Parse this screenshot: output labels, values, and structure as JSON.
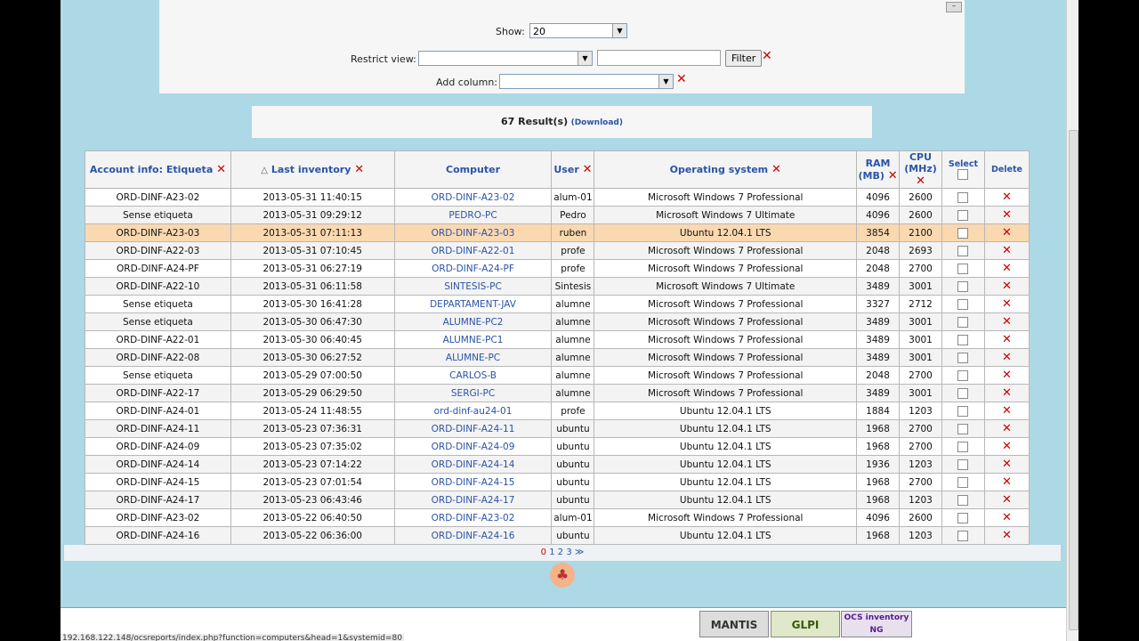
{
  "filter": {
    "show_label": "Show:",
    "show_value": "20",
    "restrict_label": "Restrict view:",
    "restrict_value": "",
    "restrict_text": "",
    "filter_button": "Filter",
    "add_column_label": "Add column:",
    "add_column_value": ""
  },
  "results": {
    "count_text": "67 Result(s)",
    "download_text": "(Download)"
  },
  "table": {
    "headers": {
      "account": "Account info: Etiqueta",
      "last_inventory": "Last inventory",
      "computer": "Computer",
      "user": "User",
      "os": "Operating system",
      "ram": "RAM (MB)",
      "cpu": "CPU (MHz)",
      "select": "Select",
      "delete": "Delete"
    },
    "rows": [
      [
        "ORD-DINF-A23-02",
        "2013-05-31 11:40:15",
        "ORD-DINF-A23-02",
        "alum-01",
        "Microsoft Windows 7 Professional",
        "4096",
        "2600"
      ],
      [
        "Sense etiqueta",
        "2013-05-31 09:29:12",
        "PEDRO-PC",
        "Pedro",
        "Microsoft Windows 7 Ultimate",
        "4096",
        "2600"
      ],
      [
        "ORD-DINF-A23-03",
        "2013-05-31 07:11:13",
        "ORD-DINF-A23-03",
        "ruben",
        "Ubuntu 12.04.1 LTS",
        "3854",
        "2100"
      ],
      [
        "ORD-DINF-A22-03",
        "2013-05-31 07:10:45",
        "ORD-DINF-A22-01",
        "profe",
        "Microsoft Windows 7 Professional",
        "2048",
        "2693"
      ],
      [
        "ORD-DINF-A24-PF",
        "2013-05-31 06:27:19",
        "ORD-DINF-A24-PF",
        "profe",
        "Microsoft Windows 7 Professional",
        "2048",
        "2700"
      ],
      [
        "ORD-DINF-A22-10",
        "2013-05-31 06:11:58",
        "SINTESIS-PC",
        "Sintesis",
        "Microsoft Windows 7 Ultimate",
        "3489",
        "3001"
      ],
      [
        "Sense etiqueta",
        "2013-05-30 16:41:28",
        "DEPARTAMENT-JAV",
        "alumne",
        "Microsoft Windows 7 Professional",
        "3327",
        "2712"
      ],
      [
        "Sense etiqueta",
        "2013-05-30 06:47:30",
        "ALUMNE-PC2",
        "alumne",
        "Microsoft Windows 7 Professional",
        "3489",
        "3001"
      ],
      [
        "ORD-DINF-A22-01",
        "2013-05-30 06:40:45",
        "ALUMNE-PC1",
        "alumne",
        "Microsoft Windows 7 Professional",
        "3489",
        "3001"
      ],
      [
        "ORD-DINF-A22-08",
        "2013-05-30 06:27:52",
        "ALUMNE-PC",
        "alumne",
        "Microsoft Windows 7 Professional",
        "3489",
        "3001"
      ],
      [
        "Sense etiqueta",
        "2013-05-29 07:00:50",
        "CARLOS-B",
        "alumne",
        "Microsoft Windows 7 Professional",
        "2048",
        "2700"
      ],
      [
        "ORD-DINF-A22-17",
        "2013-05-29 06:29:50",
        "SERGI-PC",
        "alumne",
        "Microsoft Windows 7 Professional",
        "3489",
        "3001"
      ],
      [
        "ORD-DINF-A24-01",
        "2013-05-24 11:48:55",
        "ord-dinf-au24-01",
        "profe",
        "Ubuntu 12.04.1 LTS",
        "1884",
        "1203"
      ],
      [
        "ORD-DINF-A24-11",
        "2013-05-23 07:36:31",
        "ORD-DINF-A24-11",
        "ubuntu",
        "Ubuntu 12.04.1 LTS",
        "1968",
        "2700"
      ],
      [
        "ORD-DINF-A24-09",
        "2013-05-23 07:35:02",
        "ORD-DINF-A24-09",
        "ubuntu",
        "Ubuntu 12.04.1 LTS",
        "1968",
        "2700"
      ],
      [
        "ORD-DINF-A24-14",
        "2013-05-23 07:14:22",
        "ORD-DINF-A24-14",
        "ubuntu",
        "Ubuntu 12.04.1 LTS",
        "1936",
        "1203"
      ],
      [
        "ORD-DINF-A24-15",
        "2013-05-23 07:01:54",
        "ORD-DINF-A24-15",
        "ubuntu",
        "Ubuntu 12.04.1 LTS",
        "1968",
        "2700"
      ],
      [
        "ORD-DINF-A24-17",
        "2013-05-23 06:43:46",
        "ORD-DINF-A24-17",
        "ubuntu",
        "Ubuntu 12.04.1 LTS",
        "1968",
        "1203"
      ],
      [
        "ORD-DINF-A23-02",
        "2013-05-22 06:40:50",
        "ORD-DINF-A23-02",
        "alum-01",
        "Microsoft Windows 7 Professional",
        "4096",
        "2600"
      ],
      [
        "ORD-DINF-A24-16",
        "2013-05-22 06:36:00",
        "ORD-DINF-A24-16",
        "ubuntu",
        "Ubuntu 12.04.1 LTS",
        "1968",
        "1203"
      ]
    ],
    "highlighted_row": 2
  },
  "pager": {
    "current": "0",
    "pages": [
      "1",
      "2",
      "3"
    ],
    "next": "≫"
  },
  "footer": {
    "status_url": "192.168.122.148/ocsreports/index.php?function=computers&head=1&systemid=80",
    "logos": [
      "MANTIS",
      "GLPI",
      "OCS inventory NG"
    ]
  },
  "colors": {
    "page_background": "#add8e6",
    "link_blue": "#2a53a8",
    "delete_red": "#cc0000",
    "highlight_row": "#fad8b0"
  }
}
